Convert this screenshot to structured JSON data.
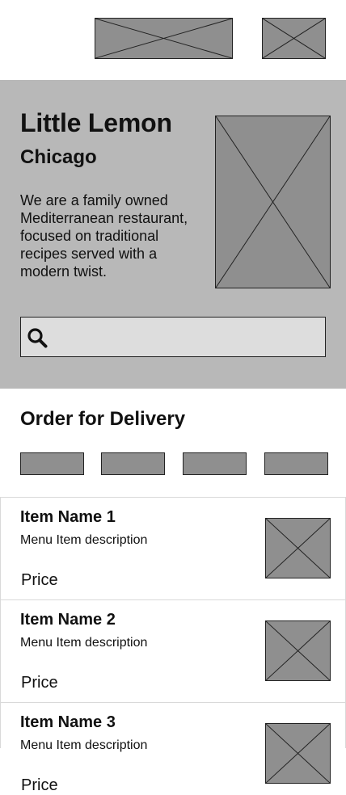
{
  "header": {
    "logo_icon": "image-placeholder-icon",
    "basket_icon": "image-placeholder-icon"
  },
  "hero": {
    "title": "Little Lemon",
    "subtitle": "Chicago",
    "description": "We are a family owned Mediterranean restaurant, focused on traditional recipes served with a modern twist.",
    "image_icon": "image-placeholder-icon",
    "search": {
      "icon": "search-icon",
      "placeholder": "",
      "value": ""
    }
  },
  "order": {
    "title": "Order for Delivery",
    "categories": [
      {
        "label": ""
      },
      {
        "label": ""
      },
      {
        "label": ""
      },
      {
        "label": ""
      }
    ]
  },
  "menu": {
    "items": [
      {
        "name": "Item Name 1",
        "description": "Menu Item description",
        "price": "Price"
      },
      {
        "name": "Item Name 2",
        "description": "Menu Item description",
        "price": "Price"
      },
      {
        "name": "Item Name 3",
        "description": "Menu Item description",
        "price": "Price"
      }
    ]
  },
  "colors": {
    "hero_background": "#b8b8b8",
    "placeholder_fill": "#8f8f8f",
    "search_fill": "#dddddd",
    "divider": "#d9d9d9"
  }
}
